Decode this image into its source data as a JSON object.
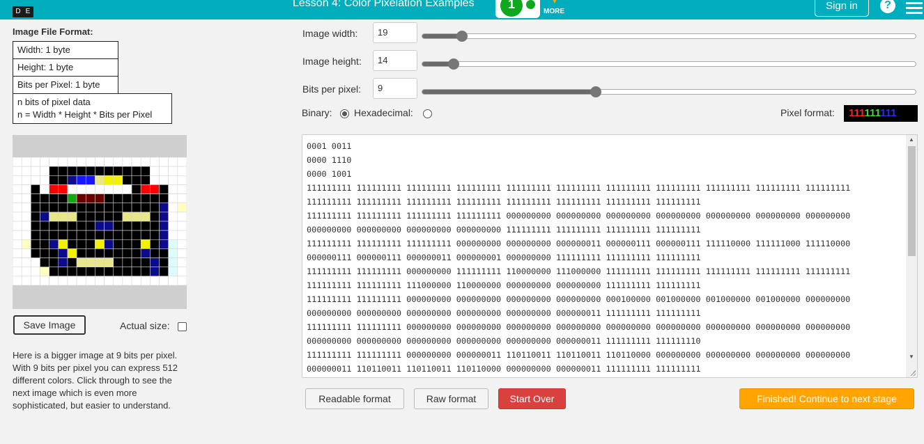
{
  "header": {
    "logo_letters": [
      "D",
      "E"
    ],
    "lesson_title": "Lesson 4: Color Pixelation Examples",
    "progress_level": "1",
    "more_label": "MORE",
    "signin_label": "Sign in",
    "help_label": "?"
  },
  "format": {
    "title": "Image File Format:",
    "width_row": "Width: 1 byte",
    "height_row": "Height: 1 byte",
    "bpp_row": "Bits per Pixel: 1 byte",
    "data_line1": "n bits of pixel data",
    "data_line2": "n = Width * Height * Bits per Pixel"
  },
  "preview": {
    "save_label": "Save Image",
    "actual_size_label": "Actual size:",
    "actual_size_checked": false
  },
  "description": "Here is a bigger image at 9 bits per pixel. With 9 bits per pixel you can express 512 different colors. Click through to see the next image which is even more sophisticated, but easier to understand.",
  "controls": {
    "width_label": "Image width:",
    "width_value": "19",
    "width_slider_fraction": 0.08,
    "height_label": "Image height:",
    "height_value": "14",
    "height_slider_fraction": 0.063,
    "bpp_label": "Bits per pixel:",
    "bpp_value": "9",
    "bpp_slider_fraction": 0.351,
    "binary_label": "Binary:",
    "binary_selected": true,
    "hex_label": "Hexadecimal:",
    "hex_selected": false,
    "pixel_format_label": "Pixel format:",
    "pixel_format_r": "111",
    "pixel_format_g": "111",
    "pixel_format_b": "111"
  },
  "data_lines": [
    "0001 0011",
    "0000 1110",
    "0000 1001",
    "111111111 111111111 111111111 111111111 111111111 111111111 111111111 111111111 111111111 111111111 111111111",
    "111111111 111111111 111111111 111111111 111111111 111111111 111111111 111111111",
    "111111111 111111111 111111111 111111111 000000000 000000000 000000000 000000000 000000000 000000000 000000000",
    "000000000 000000000 000000000 000000000 111111111 111111111 111111111 111111111",
    "111111111 111111111 111111111 000000000 000000000 000000011 000000111 000000111 111110000 111111000 111110000",
    "000000111 000000111 000000011 000000001 000000000 111111111 111111111 111111111",
    "111111111 111111111 000000000 111111111 110000000 111000000 111111111 111111111 111111111 111111111 111111111",
    "111111111 111111111 111000000 110000000 000000000 000000000 111111111 111111111",
    "111111111 111111111 000000000 000000000 000000000 000000000 000100000 001000000 001000000 001000000 000000000",
    "000000000 000000000 000000000 000000000 000000000 000000011 111111111 111111111",
    "111111111 111111111 000000000 000000000 000000000 000000000 000000000 000000000 000000000 000000000 000000000",
    "000000000 000000000 000000000 000000000 000000000 000000011 111111111 111111110",
    "111111111 111111111 000000000 000000011 110110011 110110011 110110000 000000000 000000000 000000000 000000000",
    "000000011 110110011 110110011 110110000 000000000 000000011 111111111 111111111"
  ],
  "buttons": {
    "readable": "Readable format",
    "raw": "Raw format",
    "start_over": "Start Over",
    "finished": "Finished! Continue to next stage"
  },
  "pixel_image": {
    "columns": 19,
    "rows": 14,
    "palette": {
      "W": "#ffffff",
      "K": "#000000",
      "R": "#ff0000",
      "G": "#11aa11",
      "B": "#1515ff",
      "N": "#0c0c8a",
      "Y": "#f2f200",
      "L": "#e7e78a",
      "M": "#6a0000",
      "C": "#dffcfc",
      "P": "#ffffc0",
      "D": "#141414"
    },
    "pixels": [
      "WWWWWWWWWWWWWWWWWWW",
      "WWWWKKKKKKKKKKKWWWW",
      "WWWWKKNBBLYYKKKWWWW",
      "WWKWRRWWWWWWWKRRKWW",
      "WWKKKKGMMMKKKKKKKWW",
      "WWKKKKKKKKKKKKKKNWP",
      "WWKNLLLKKKKKLLLKNWW",
      "WWKKKKKKKNNKKKKKNWW",
      "WWKKKKKKKKKKKKKKNWW",
      "WPKKNYKKKYNKKKYKNCW",
      "WWKKKNYKKKKKKKNKKCW",
      "WWWKKNKLLLLKKKKNKCW",
      "WWWPKKKKKKKKKKKNKCW",
      "WWWWWWWWWWWWWWWWWWW"
    ]
  }
}
